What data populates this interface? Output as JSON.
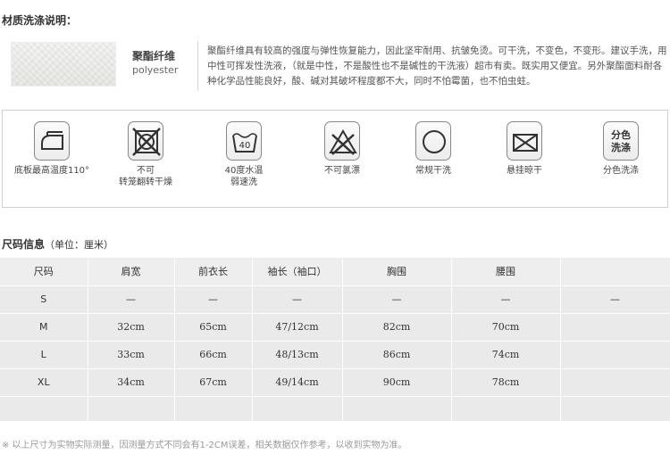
{
  "material": {
    "title": "材质洗涤说明：",
    "fabric_name": "聚酯纤维",
    "fabric_en": "polyester",
    "description": "聚酯纤维具有较高的强度与弹性恢复能力，因此坚牢耐用、抗皱免烫。可干洗，不变色，不变形。建议手洗，用中性可挥发性洗液，（就是中性，不是酸性也不是碱性的干洗液）超市有卖。既实用又便宜。另外聚酯面料耐各种化学品性能良好，酸、碱对其破坏程度都不大，同时不怕霉菌，也不怕虫蛀。"
  },
  "care": {
    "items": [
      {
        "icon": "iron-icon",
        "label": "底板最高温度110°"
      },
      {
        "icon": "no-tumble-dry-icon",
        "label": "不可\n转笼翻转干燥"
      },
      {
        "icon": "wash-40-icon",
        "label": "40度水温\n弱速洗",
        "icon_text": "40"
      },
      {
        "icon": "no-bleach-icon",
        "label": "不可氯漂"
      },
      {
        "icon": "dry-clean-icon",
        "label": "常规干洗"
      },
      {
        "icon": "hang-dry-icon",
        "label": "悬挂晾干"
      },
      {
        "icon": "wash-separately-icon",
        "label": "分色洗涤",
        "icon_text": "分色\n洗涤"
      }
    ]
  },
  "size": {
    "title": "尺码信息",
    "unit": "（单位：厘米）",
    "headers": [
      "尺码",
      "肩宽",
      "前衣长",
      "袖长（袖口）",
      "胸围",
      "腰围",
      ""
    ],
    "rows": [
      [
        "S",
        "—",
        "—",
        "—",
        "—",
        "—",
        "—"
      ],
      [
        "M",
        "32cm",
        "65cm",
        "47/12cm",
        "82cm",
        "70cm",
        ""
      ],
      [
        "L",
        "33cm",
        "66cm",
        "48/13cm",
        "86cm",
        "74cm",
        ""
      ],
      [
        "XL",
        "34cm",
        "67cm",
        "49/14cm",
        "90cm",
        "78cm",
        ""
      ]
    ]
  },
  "footnote": "※ 以上尺寸为实物实际测量，因测量方式不同会有1-2CM误差，相关数据仅作参考，以收到实物为准。"
}
